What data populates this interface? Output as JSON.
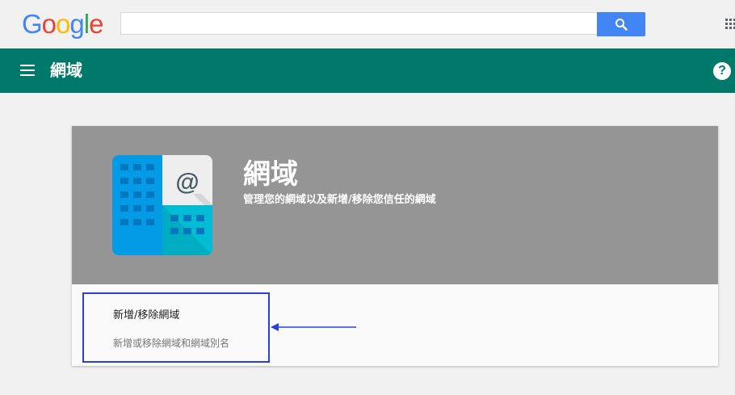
{
  "google": {
    "logo_letters": [
      {
        "char": "G",
        "color": "#4285f4"
      },
      {
        "char": "o",
        "color": "#ea4335"
      },
      {
        "char": "o",
        "color": "#fbbc05"
      },
      {
        "char": "g",
        "color": "#4285f4"
      },
      {
        "char": "l",
        "color": "#34a853"
      },
      {
        "char": "e",
        "color": "#ea4335"
      }
    ],
    "search": {
      "value": "",
      "placeholder": ""
    }
  },
  "header": {
    "title": "網域",
    "color": "#00796b"
  },
  "card": {
    "title": "網域",
    "subtitle": "管理您的網域以及新增/移除您信任的網域",
    "items": [
      {
        "title": "新增/移除網域",
        "description": "新增或移除網域和網域別名"
      }
    ]
  },
  "icons": {
    "menu": "hamburger-menu-icon",
    "search": "search-icon",
    "apps": "apps-grid-icon",
    "help": "help-icon",
    "domains": "domains-building-icon"
  },
  "colors": {
    "highlight": "#2a3fdd",
    "search_button": "#4285f4",
    "hero": "#959595"
  }
}
